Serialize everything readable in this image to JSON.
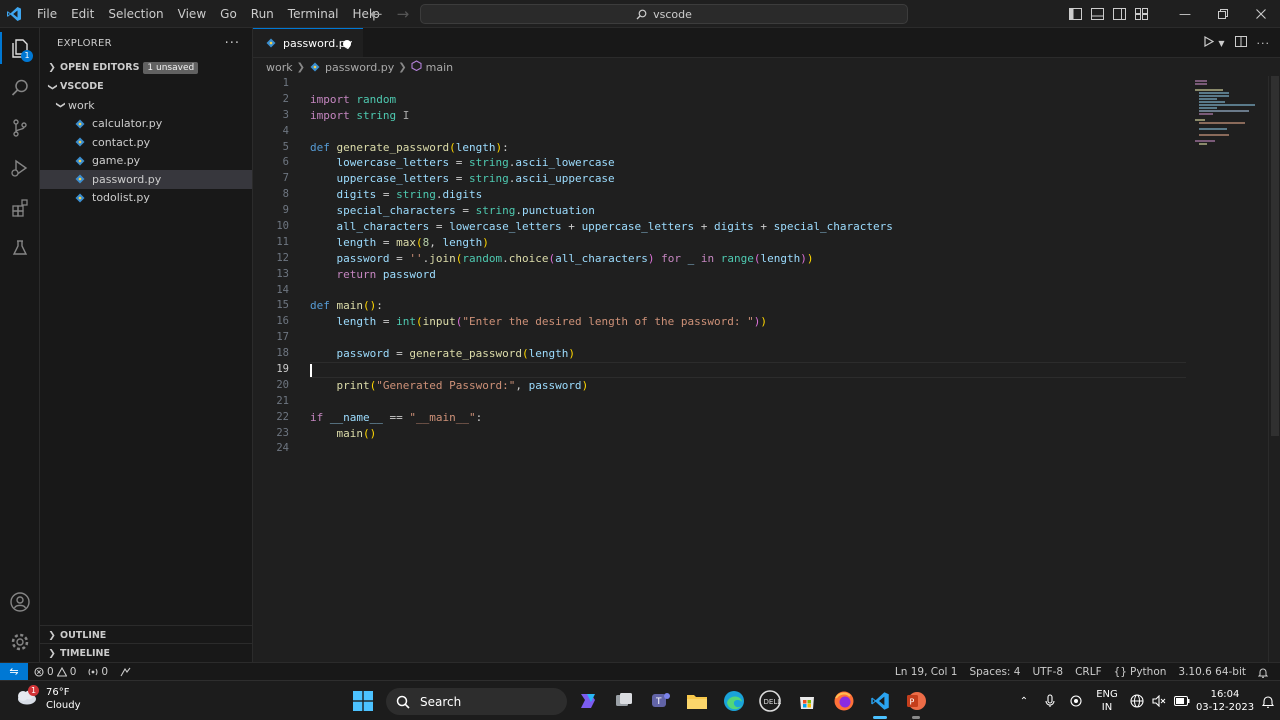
{
  "titlebar": {
    "menu": [
      "File",
      "Edit",
      "Selection",
      "View",
      "Go",
      "Run",
      "Terminal",
      "Help"
    ],
    "search_text": "vscode"
  },
  "activity": {
    "explorer_badge": "1"
  },
  "sidebar": {
    "title": "EXPLORER",
    "open_editors_label": "OPEN EDITORS",
    "unsaved_badge": "1 unsaved",
    "workspace_label": "VSCODE",
    "folder": "work",
    "files": [
      "calculator.py",
      "contact.py",
      "game.py",
      "password.py",
      "todolist.py"
    ],
    "selected_file": "password.py",
    "outline_label": "OUTLINE",
    "timeline_label": "TIMELINE"
  },
  "editor": {
    "tab_label": "password.py",
    "breadcrumb": [
      "work",
      "password.py",
      "main"
    ],
    "line_numbers": [
      "1",
      "2",
      "3",
      "4",
      "5",
      "6",
      "7",
      "8",
      "9",
      "10",
      "11",
      "12",
      "13",
      "14",
      "15",
      "16",
      "17",
      "18",
      "19",
      "20",
      "21",
      "22",
      "23",
      "24"
    ],
    "active_line": 19,
    "code": {
      "l2_kw": "import",
      "l2_mod": "random",
      "l3_kw": "import",
      "l3_mod": "string",
      "l5_kw": "def",
      "l5_fn": "generate_password",
      "l5_param": "length",
      "l6_var": "lowercase_letters",
      "l6_mod": "string",
      "l6_attr": "ascii_lowercase",
      "l7_var": "uppercase_letters",
      "l7_mod": "string",
      "l7_attr": "ascii_uppercase",
      "l8_var": "digits",
      "l8_mod": "string",
      "l8_attr": "digits",
      "l9_var": "special_characters",
      "l9_mod": "string",
      "l9_attr": "punctuation",
      "l10_var": "all_characters",
      "l10_a": "lowercase_letters",
      "l10_b": "uppercase_letters",
      "l10_c": "digits",
      "l10_d": "special_characters",
      "l11_var": "length",
      "l11_fn": "max",
      "l11_num": "8",
      "l11_arg": "length",
      "l12_var": "password",
      "l12_str": "''",
      "l12_join": "join",
      "l12_mod": "random",
      "l12_choice": "choice",
      "l12_arg": "all_characters",
      "l12_for": "for",
      "l12_us": "_",
      "l12_in": "in",
      "l12_range": "range",
      "l12_len": "length",
      "l13_kw": "return",
      "l13_var": "password",
      "l15_kw": "def",
      "l15_fn": "main",
      "l16_var": "length",
      "l16_int": "int",
      "l16_input": "input",
      "l16_str": "\"Enter the desired length of the password: \"",
      "l18_var": "password",
      "l18_fn": "generate_password",
      "l18_arg": "length",
      "l20_fn": "print",
      "l20_str": "\"Generated Password:\"",
      "l20_arg": "password",
      "l22_kw": "if",
      "l22_var": "__name__",
      "l22_str": "\"__main__\"",
      "l23_fn": "main"
    }
  },
  "statusbar": {
    "errors": "0",
    "warnings": "0",
    "ports": "0",
    "position": "Ln 19, Col 1",
    "spaces": "Spaces: 4",
    "encoding": "UTF-8",
    "eol": "CRLF",
    "language": "Python",
    "interpreter": "3.10.6 64-bit"
  },
  "taskbar": {
    "temperature": "76°F",
    "weather": "Cloudy",
    "weather_badge": "1",
    "search_label": "Search",
    "lang_top": "ENG",
    "lang_bottom": "IN",
    "time": "16:04",
    "date": "03-12-2023"
  },
  "colors": {
    "accent": "#0078d4",
    "keyword": "#c586c0",
    "function": "#dcdcaa",
    "string": "#ce9178",
    "variable": "#9cdcfe"
  }
}
